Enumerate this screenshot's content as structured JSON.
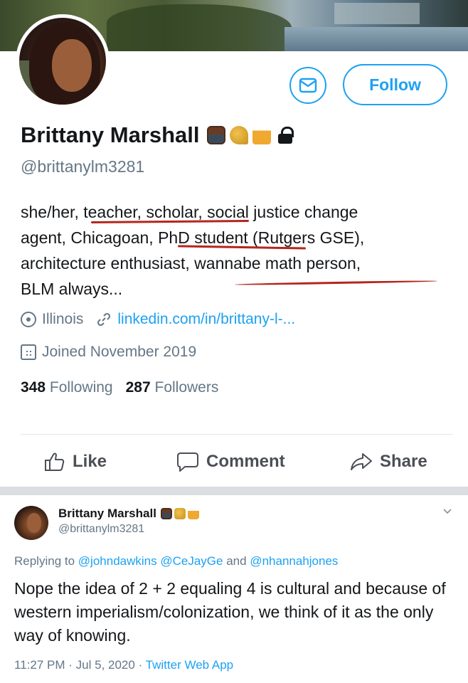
{
  "profile": {
    "display_name": "Brittany Marshall",
    "emojis": [
      "teacher-emoji",
      "taco-emoji",
      "beer-mugs-emoji"
    ],
    "handle": "@brittanylm3281",
    "bio_lines": [
      "she/her, teacher, scholar, social justice change",
      "agent, Chicagoan, PhD student (Rutgers GSE),",
      "architecture enthusiast, wannabe math person,",
      "BLM always..."
    ],
    "location": "Illinois",
    "website": "linkedin.com/in/brittany-l-...",
    "joined": "Joined November 2019",
    "following_count": "348",
    "following_label": "Following",
    "followers_count": "287",
    "followers_label": "Followers",
    "follow_button": "Follow",
    "colors": {
      "accent": "#1da1f2",
      "secondary_text": "#657786",
      "annotation": "#b3261e"
    }
  },
  "facebook_bar": {
    "like": "Like",
    "comment": "Comment",
    "share": "Share"
  },
  "tweet": {
    "author_name": "Brittany Marshall",
    "author_handle": "@brittanylm3281",
    "replying_prefix": "Replying to",
    "reply_handles": [
      "@johndawkins",
      "@CeJayGe",
      "@nhannahjones"
    ],
    "reply_and": "and",
    "text": "Nope the idea of 2 + 2 equaling 4 is cultural and because of western imperialism/colonization, we think of it as the only way of knowing.",
    "time": "11:27 PM",
    "separator": "·",
    "date": "Jul 5, 2020",
    "source": "Twitter Web App"
  }
}
